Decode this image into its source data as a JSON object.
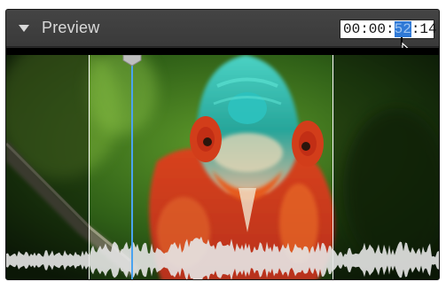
{
  "panel": {
    "title": "Preview",
    "timecode": {
      "before": "00:00:",
      "selected": "52",
      "after": ":14"
    }
  },
  "icons": {
    "collapse": "triangle-down-icon",
    "cursor": "mouse-pointer-icon",
    "playhead": "playhead-marker-icon"
  },
  "colors": {
    "header_bg": "#3d3d3d",
    "title_text": "#d9d9d9",
    "selection": "#2f79d6",
    "playhead": "#4aa3f0",
    "waveform": "#e6e6e6"
  }
}
